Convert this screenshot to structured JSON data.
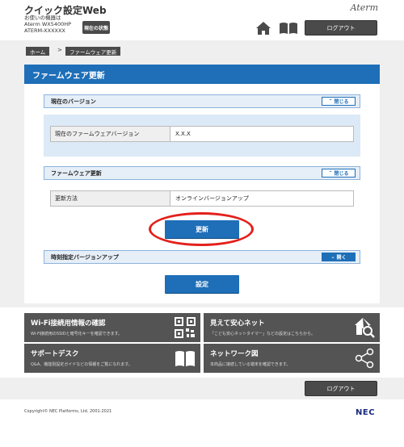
{
  "header": {
    "app_title": "クイック設定Web",
    "device_line1": "お使いの機器は",
    "device_line2": "Aterm WX5400HP",
    "device_line3": "ATERM-XXXXXX",
    "status_button": "現在の状態",
    "brand": "Aterm",
    "logout": "ログアウト"
  },
  "breadcrumb": {
    "home": "ホーム",
    "separator": ">",
    "current": "ファームウェア更新"
  },
  "page": {
    "heading": "ファームウェア更新"
  },
  "current_version": {
    "title": "現在のバージョン",
    "toggle": "閉じる",
    "field_label": "現在のファームウェアバージョン",
    "field_value": "X.X.X"
  },
  "firmware_update": {
    "title": "ファームウェア更新",
    "toggle": "閉じる",
    "field_label": "更新方法",
    "field_value": "オンラインバージョンアップ",
    "update_button": "更新"
  },
  "scheduled_update": {
    "title": "時刻指定バージョンアップ",
    "toggle": "開く",
    "set_button": "設定"
  },
  "tiles": [
    {
      "title": "Wi-Fi接続用情報の確認",
      "desc": "Wi-Fi接続用のSSIDと暗号化キーを確認できます。",
      "icon": "qr-code-icon"
    },
    {
      "title": "見えて安心ネット",
      "desc": "「こども安心ネットタイマー」などの設定はこちらから。",
      "icon": "home-search-icon"
    },
    {
      "title": "サポートデスク",
      "desc": "Q&A、機能別設定ガイドなどの情報をご覧になれます。",
      "icon": "book-icon"
    },
    {
      "title": "ネットワーク図",
      "desc": "本商品に接続している端末を確認できます。",
      "icon": "network-icon"
    }
  ],
  "footer": {
    "logout": "ログアウト",
    "copyright": "Copyright© NEC Platforms, Ltd. 2001-2021",
    "logo": "NEC"
  },
  "colors": {
    "accent": "#1e6fb8",
    "dark_button": "#4a4a4a",
    "highlight": "#e3201b"
  }
}
